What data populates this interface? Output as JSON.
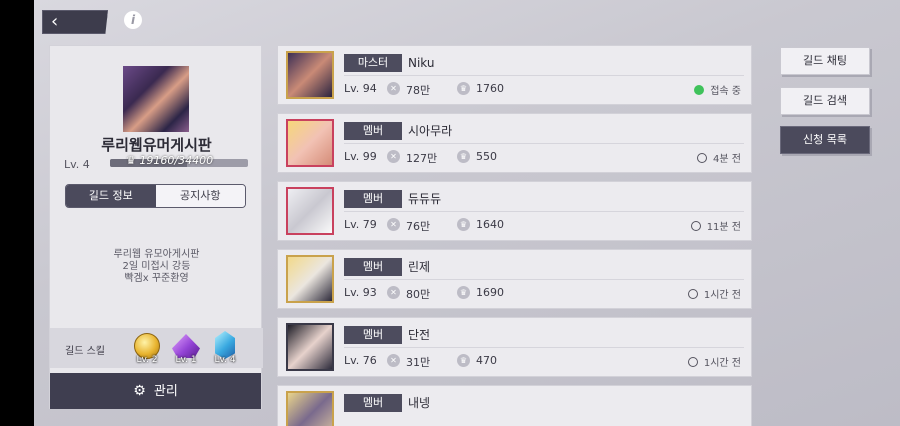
{
  "header": {
    "back_icon": "‹",
    "info_icon": "i"
  },
  "guild": {
    "name": "루리웹유머게시판",
    "level": "Lv. 4",
    "exp_text": "19160/34400",
    "exp_fraction": 0.557,
    "tabs": [
      "길드 정보",
      "공지사항"
    ],
    "notice_lines": [
      "루리웹 유모아게시판",
      "2일 미접시 강등",
      "빡겜x 꾸준환영"
    ],
    "skills_label": "길드 스킬",
    "skills": [
      {
        "icon": "gold-coin-icon",
        "level": "Lv. 2"
      },
      {
        "icon": "purple-crystal-icon",
        "level": "Lv. 1"
      },
      {
        "icon": "blue-gem-icon",
        "level": "Lv. 4"
      }
    ],
    "manage_label": "관리"
  },
  "members": [
    {
      "role": "마스터",
      "name": "Niku",
      "level": "Lv. 94",
      "power": "78만",
      "contribution": "1760",
      "status": "접속 중",
      "online": true
    },
    {
      "role": "멤버",
      "name": "시아무라",
      "level": "Lv. 99",
      "power": "127만",
      "contribution": "550",
      "status": "4분 전",
      "online": false
    },
    {
      "role": "멤버",
      "name": "듀듀듀",
      "level": "Lv. 79",
      "power": "76만",
      "contribution": "1640",
      "status": "11분 전",
      "online": false
    },
    {
      "role": "멤버",
      "name": "린제",
      "level": "Lv. 93",
      "power": "80만",
      "contribution": "1690",
      "status": "1시간 전",
      "online": false
    },
    {
      "role": "멤버",
      "name": "단전",
      "level": "Lv. 76",
      "power": "31만",
      "contribution": "470",
      "status": "1시간 전",
      "online": false
    },
    {
      "role": "멤버",
      "name": "내넹",
      "level": "",
      "power": "",
      "contribution": "",
      "status": "",
      "online": false
    }
  ],
  "side_buttons": {
    "chat": "길드 채팅",
    "search": "길드 검색",
    "applications": "신청 목록"
  },
  "colors": {
    "online": "#3fc25b",
    "badge": "#4d4c5e"
  }
}
